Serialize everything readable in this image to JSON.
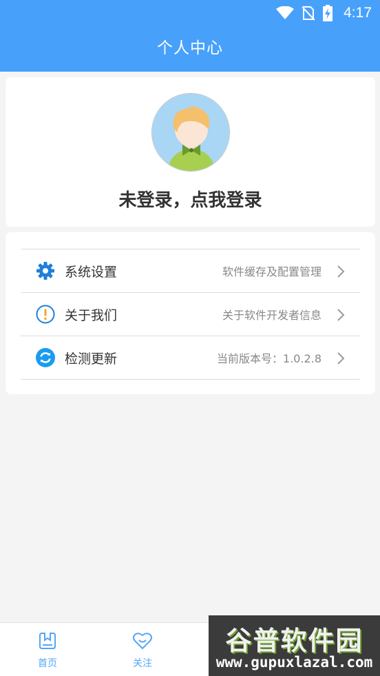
{
  "status_bar": {
    "time": "4:17",
    "icons": [
      "wifi-icon",
      "no-sim-icon",
      "battery-charging-icon"
    ]
  },
  "header": {
    "title": "个人中心",
    "background": "#47a1fb"
  },
  "profile": {
    "login_prompt": "未登录，点我登录"
  },
  "menu": {
    "items": [
      {
        "icon": "gear-icon",
        "label": "系统设置",
        "desc": "软件缓存及配置管理"
      },
      {
        "icon": "info-icon",
        "label": "关于我们",
        "desc": "关于软件开发者信息"
      },
      {
        "icon": "refresh-icon",
        "label": "检测更新",
        "desc": "当前版本号：1.0.2.8"
      }
    ]
  },
  "tabbar": {
    "accent": "#52a6f7",
    "tabs": [
      {
        "icon": "home-icon",
        "label": "首页"
      },
      {
        "icon": "heart-icon",
        "label": "关注"
      }
    ]
  },
  "watermark": {
    "title": "谷普软件园",
    "url": "www.gupuxlazal.com"
  }
}
